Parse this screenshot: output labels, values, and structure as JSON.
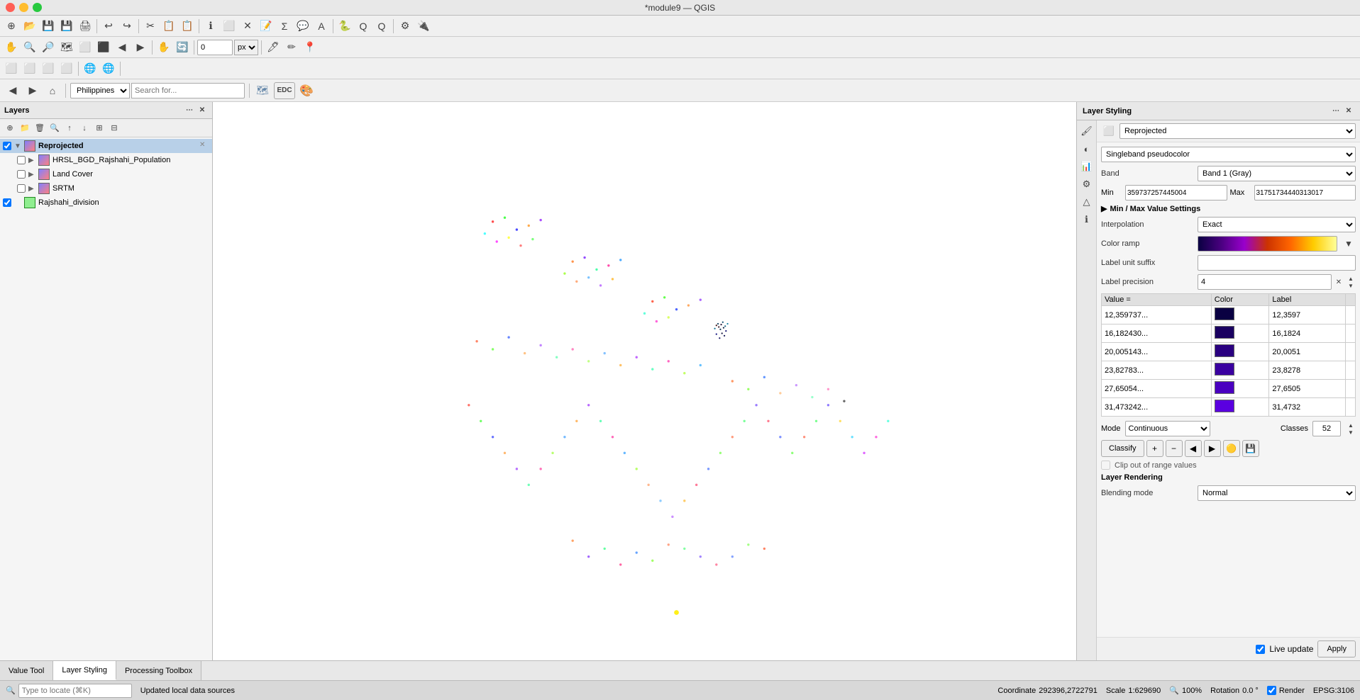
{
  "window": {
    "title": "*module9 — QGIS"
  },
  "toolbars": {
    "tb1_icons": [
      "⊕",
      "📂",
      "💾",
      "💾",
      "🖨",
      "↩",
      "↪",
      "✂",
      "📋",
      "📋",
      "📋",
      "🔎",
      "🔍",
      "🗺",
      "🔀",
      "🔍",
      "🔍",
      "🔍",
      "⬜",
      "📍",
      "ℹ",
      "🖊",
      "🖊",
      "⬛",
      "⬤",
      "📝",
      "🗑",
      "⬜",
      "↩",
      "↪",
      "🔧"
    ],
    "tb2_icons": [
      "🖱",
      "✋",
      "✋",
      "🗺",
      "🔎",
      "🔍",
      "◻",
      "⬜",
      "⬛",
      "📍",
      "📍",
      "ℹ",
      "🖊"
    ],
    "tb3_icons": [
      "⬜",
      "⬜",
      "⬜",
      "⬜",
      "⬜",
      "⬜",
      "⬜"
    ]
  },
  "nav": {
    "zoom_value": "0",
    "zoom_unit": "px",
    "location_placeholder": "Search for...",
    "crs_label": "Philippines"
  },
  "layers": {
    "title": "Layers",
    "toolbar_icons": [
      "⊕",
      "⊕",
      "⊕",
      "🔧",
      "🔍",
      "↑",
      "↓",
      "🗑",
      "👁",
      "👁"
    ],
    "items": [
      {
        "id": "reprojected",
        "name": "Reprojected",
        "checked": true,
        "expanded": true,
        "bold": true,
        "icon": "raster",
        "indent": 0
      },
      {
        "id": "hrsl_bgd",
        "name": "HRSL_BGD_Rajshahi_Population",
        "checked": false,
        "expanded": false,
        "bold": false,
        "icon": "raster",
        "indent": 1
      },
      {
        "id": "land_cover",
        "name": "Land Cover",
        "checked": false,
        "expanded": false,
        "bold": false,
        "icon": "raster",
        "indent": 1
      },
      {
        "id": "srtm",
        "name": "SRTM",
        "checked": false,
        "expanded": false,
        "bold": false,
        "icon": "raster",
        "indent": 1
      },
      {
        "id": "rajshahi_div",
        "name": "Rajshahi_division",
        "checked": true,
        "expanded": false,
        "bold": false,
        "icon": "vector-poly",
        "indent": 0
      }
    ]
  },
  "map": {
    "background": "#ffffff"
  },
  "styling": {
    "title": "Layer Styling",
    "layer_name": "Reprojected",
    "renderer_label": "Singleband pseudocolor",
    "band_label": "Band",
    "band_value": "Band 1 (Gray)",
    "min_label": "Min",
    "min_value": "359737257445004",
    "max_label": "Max",
    "max_value": "31751734440313017",
    "minmax_section": "Min / Max Value Settings",
    "interpolation_label": "Interpolation",
    "interpolation_value": "Exact",
    "color_ramp_label": "Color ramp",
    "label_unit_label": "Label unit suffix",
    "label_unit_value": "",
    "label_precision_label": "Label precision",
    "label_precision_value": "4",
    "table_headers": [
      "Value =",
      "Color",
      "Label"
    ],
    "table_rows": [
      {
        "value": "12,359737...",
        "color": "#0a0042",
        "label": "12,3597"
      },
      {
        "value": "16,182430...",
        "color": "#1a0060",
        "label": "16,1824"
      },
      {
        "value": "20,005143...",
        "color": "#2a0080",
        "label": "20,0051"
      },
      {
        "value": "23,82783...",
        "color": "#3a00a0",
        "label": "23,8278"
      },
      {
        "value": "27,65054...",
        "color": "#4a00c0",
        "label": "27,6505"
      },
      {
        "value": "31,473242...",
        "color": "#5a00e0",
        "label": "31,4732"
      }
    ],
    "mode_label": "Mode",
    "mode_value": "Continuous",
    "classes_label": "Classes",
    "classes_value": "52",
    "classify_label": "Classify",
    "btn_plus": "+",
    "btn_minus": "−",
    "btn_left": "◀",
    "btn_right": "▶",
    "btn_save": "💾",
    "clip_label": "Clip out of range values",
    "rendering_title": "Layer Rendering",
    "blending_label": "Blending mode",
    "blending_value": "Normal",
    "live_update_label": "Live update",
    "apply_label": "Apply"
  },
  "bottom_tabs": [
    {
      "id": "value-tool",
      "label": "Value Tool"
    },
    {
      "id": "layer-styling",
      "label": "Layer Styling"
    },
    {
      "id": "processing-toolbox",
      "label": "Processing Toolbox"
    }
  ],
  "status": {
    "locate_placeholder": "Type to locate (⌘K)",
    "local_data": "Updated local data sources",
    "coordinate_label": "Coordinate",
    "coordinate_value": "292396,2722791",
    "scale_label": "Scale",
    "scale_value": "1:629690",
    "magnifier_label": "Magnifier",
    "magnifier_value": "100%",
    "rotation_label": "Rotation",
    "rotation_value": "0.0 °",
    "render_label": "Render",
    "epsg_label": "EPSG:3106"
  }
}
